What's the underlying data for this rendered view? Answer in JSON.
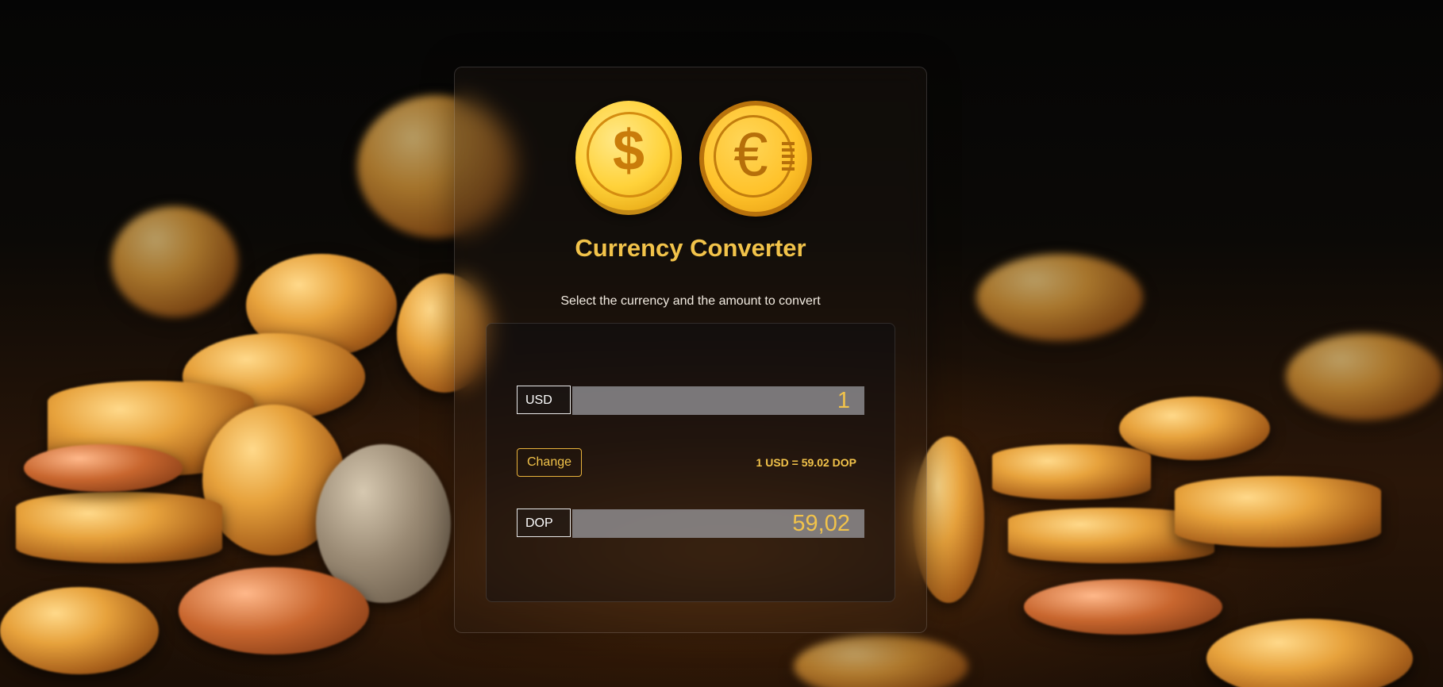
{
  "app": {
    "title": "Currency Converter",
    "subtitle": "Select the currency and the amount to convert"
  },
  "logos": {
    "first": "dollar-coin-icon",
    "second": "euro-coin-icon",
    "dollar_symbol": "$",
    "euro_symbol": "€"
  },
  "converter": {
    "from_currency": "USD",
    "from_amount": "1",
    "change_label": "Change",
    "rate_text": "1 USD = 59.02 DOP",
    "to_currency": "DOP",
    "to_amount": "59,02"
  },
  "colors": {
    "accent": "#f2c34a",
    "text": "#ffffff"
  }
}
